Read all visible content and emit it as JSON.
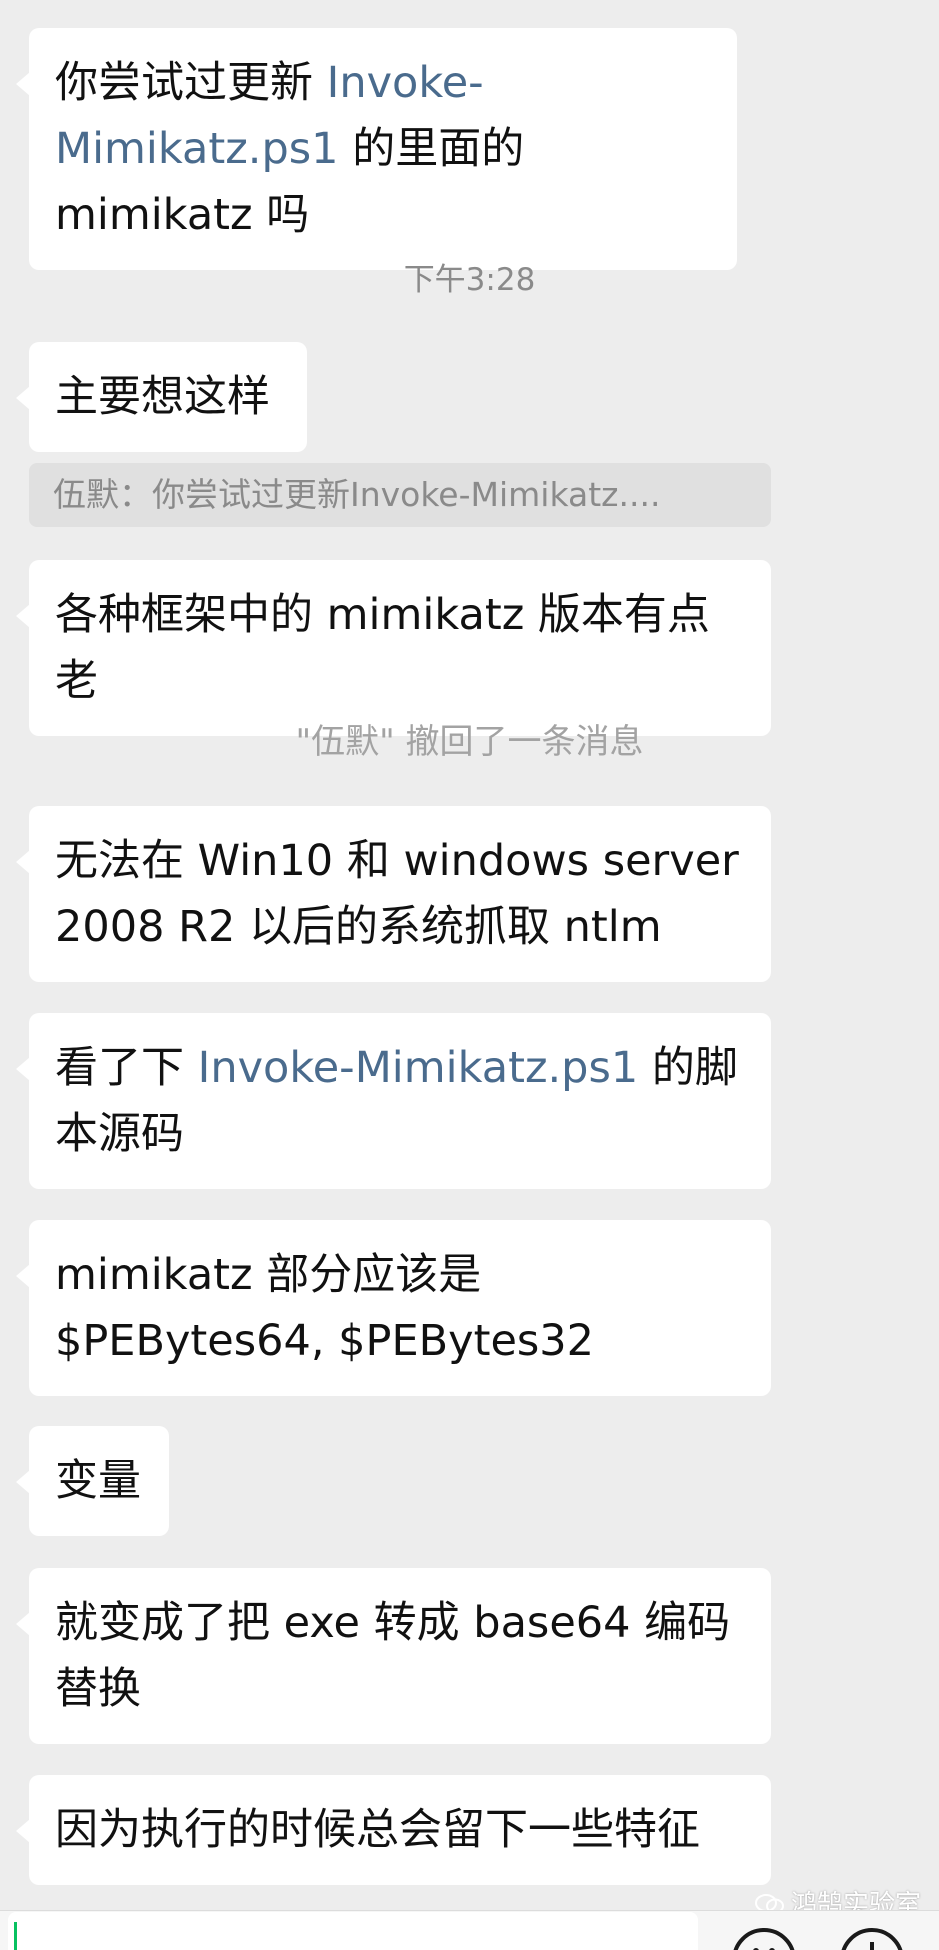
{
  "messages": [
    {
      "segments": [
        "你尝试过更新 ",
        "Invoke-Mimikatz.ps1",
        " 的里面的 mimikatz 吗"
      ]
    },
    {
      "text": "主要想这样"
    },
    {
      "text": "各种框架中的 mimikatz 版本有点老"
    },
    {
      "text": "无法在 Win10 和 windows server 2008 R2 以后的系统抓取 ntlm"
    },
    {
      "segments": [
        "看了下 ",
        "Invoke-Mimikatz.ps1",
        " 的脚本源码"
      ]
    },
    {
      "text": "mimikatz 部分应该是 $PEBytes64, $PEBytes32"
    },
    {
      "text": "变量"
    },
    {
      "text": "就变成了把 exe 转成 base64 编码替换"
    },
    {
      "text": "因为执行的时候总会留下一些特征"
    }
  ],
  "timestamp": "下午3:28",
  "quote": "伍默：你尝试过更新Invoke-Mimikatz....",
  "recall_notice": "\"伍默\" 撤回了一条消息",
  "watermark": "鸿鹄实验室",
  "colors": {
    "background": "#ededed",
    "bubble": "#ffffff",
    "link": "#4a6b8d",
    "meta_text": "#8a8a8a"
  },
  "icons": [
    "emoji-icon",
    "plus-icon",
    "wechat-watermark-icon"
  ]
}
